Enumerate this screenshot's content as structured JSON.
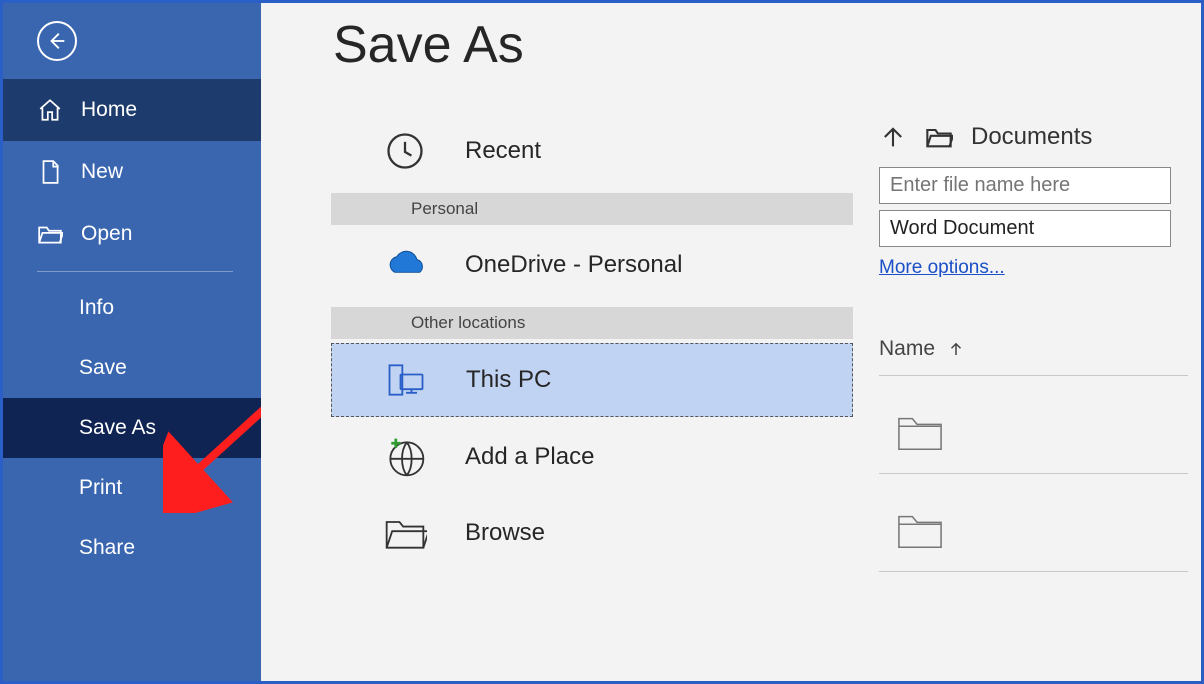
{
  "page_title": "Save As",
  "nav": {
    "primary": [
      {
        "label": "Home",
        "icon": "home-icon",
        "active": true
      },
      {
        "label": "New",
        "icon": "file-icon",
        "active": false
      },
      {
        "label": "Open",
        "icon": "folder-icon",
        "active": false
      }
    ],
    "secondary": [
      {
        "label": "Info",
        "selected": false
      },
      {
        "label": "Save",
        "selected": false
      },
      {
        "label": "Save As",
        "selected": true
      },
      {
        "label": "Print",
        "selected": false
      },
      {
        "label": "Share",
        "selected": false
      }
    ]
  },
  "locations": {
    "recent_label": "Recent",
    "personal_header": "Personal",
    "personal": [
      {
        "label": "OneDrive - Personal",
        "icon": "onedrive-icon"
      }
    ],
    "other_header": "Other locations",
    "other": [
      {
        "label": "This PC",
        "icon": "thispc-icon",
        "selected": true
      },
      {
        "label": "Add a Place",
        "icon": "addplace-icon",
        "selected": false
      },
      {
        "label": "Browse",
        "icon": "browse-icon",
        "selected": false
      }
    ]
  },
  "save_panel": {
    "breadcrumb_label": "Documents",
    "filename_placeholder": "Enter file name here",
    "filetype_value": "Word Document",
    "more_options_label": "More options...",
    "column_name_label": "Name"
  }
}
